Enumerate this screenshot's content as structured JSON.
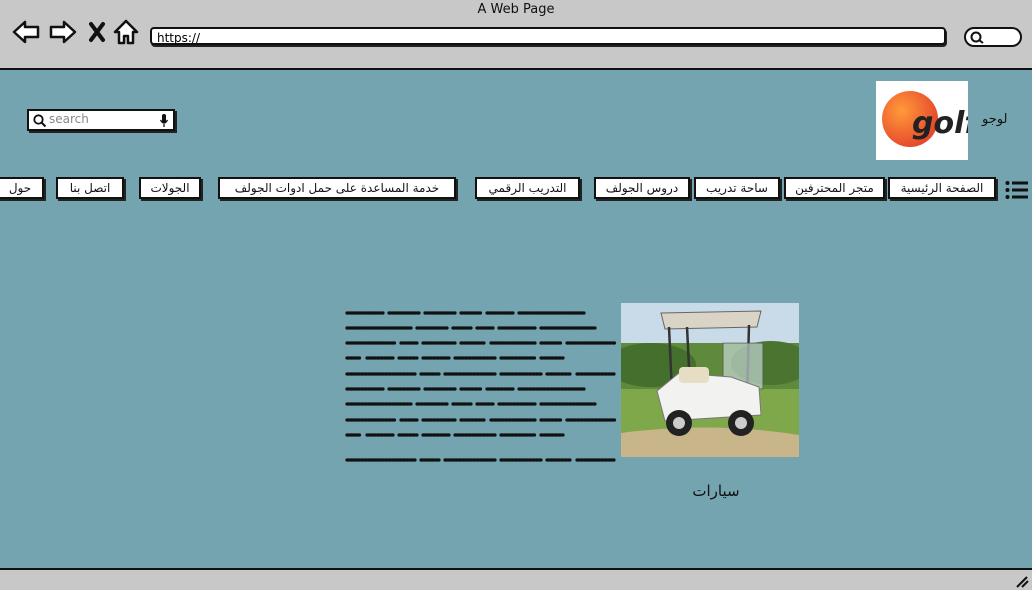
{
  "window": {
    "title": "A Web Page"
  },
  "address_bar": {
    "url": "https://"
  },
  "header": {
    "search_placeholder": "search",
    "logo_text": "لوجو",
    "logo_image_text": "golf"
  },
  "nav": {
    "items": [
      "الصفحة الرئيسية",
      "متجر المحترفين",
      "ساحة تدريب",
      "دروس الجولف",
      "التدريب الرقمي",
      "خدمة المساعدة على حمل ادوات الجولف",
      "الجولات",
      "اتصل بنا",
      "حول"
    ]
  },
  "content": {
    "caption": "سيارات"
  },
  "colors": {
    "page_bg": "#73a4af",
    "chrome_bg": "#c8c8c8",
    "logo_orange": "#f07a2a"
  }
}
